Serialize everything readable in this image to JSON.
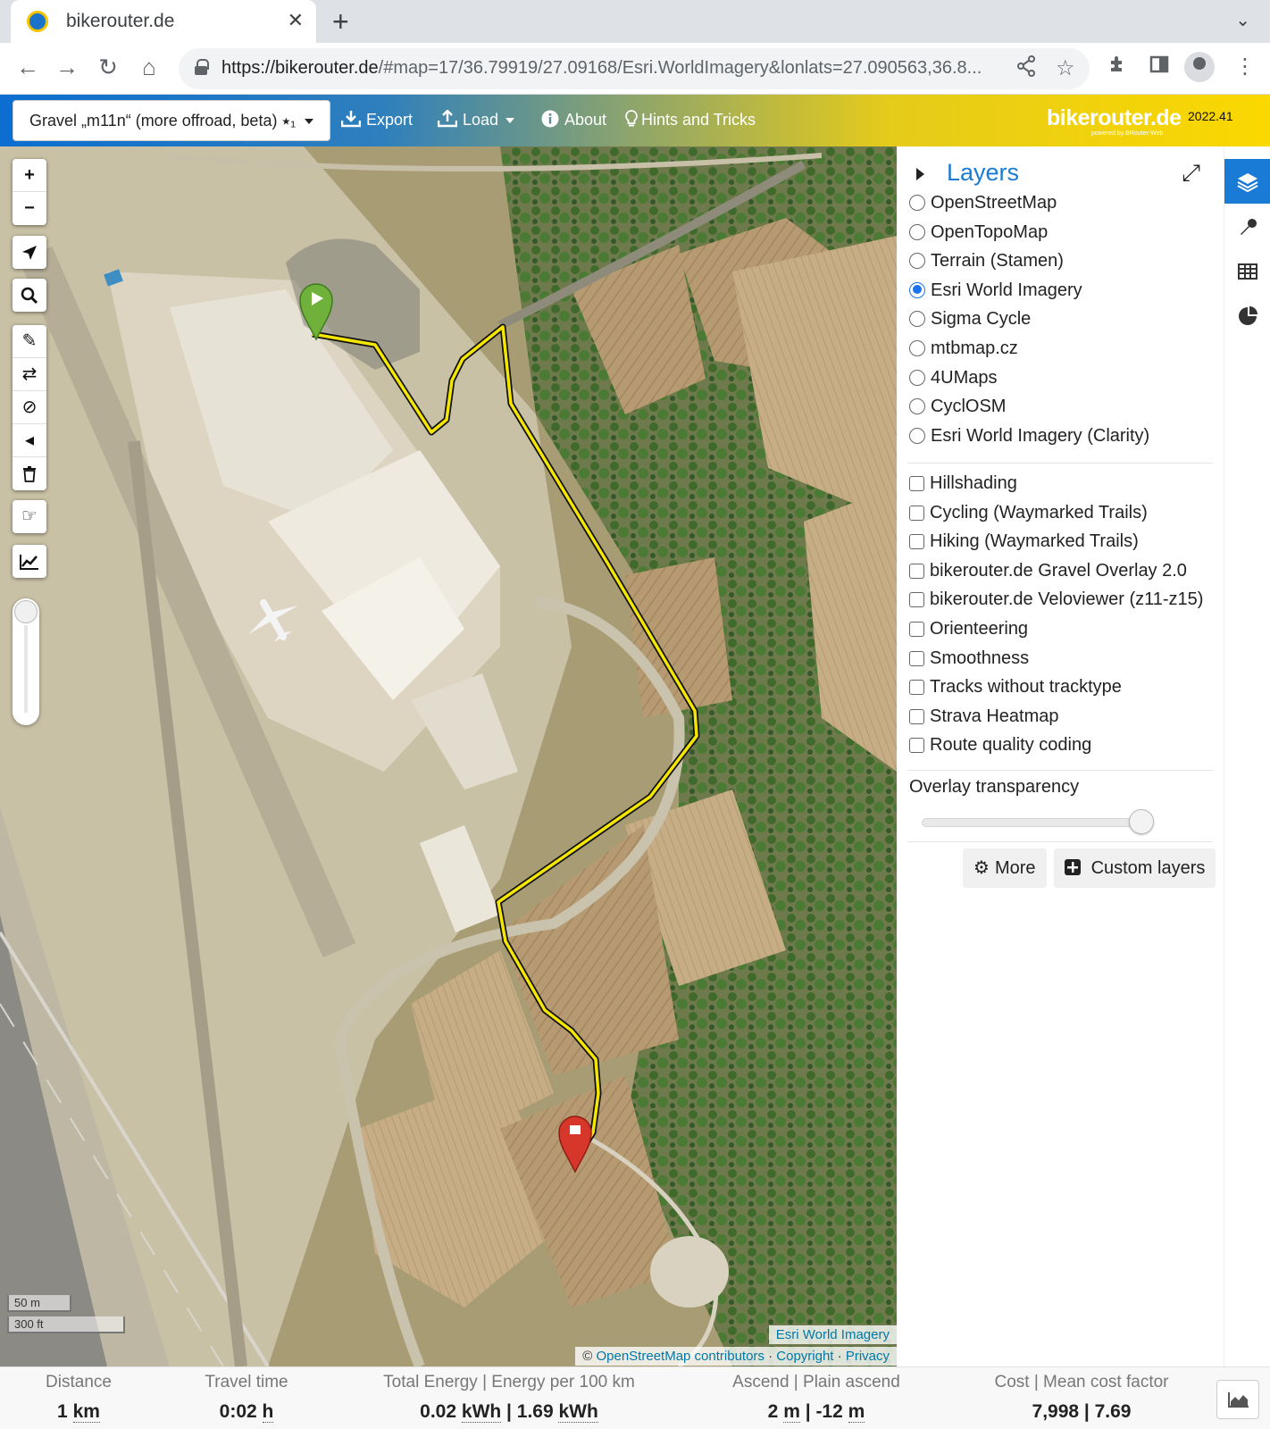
{
  "browser": {
    "tab_title": "bikerouter.de",
    "close_glyph": "✕",
    "newtab_glyph": "+",
    "url_host": "https://bikerouter.de",
    "url_rest": "/#map=17/36.79919/27.09168/Esri.WorldImagery&lonlats=27.090563,36.8..."
  },
  "appbar": {
    "profile": "Gravel „m11n“ (more offroad, beta) ⭑₁",
    "export": "Export",
    "load": "Load",
    "about": "About",
    "hints": "Hints and Tricks",
    "brand": "bikerouter.de",
    "brand_sub": "powered by BRouter-Web",
    "version": "2022.41"
  },
  "map": {
    "scale_metric": "50 m",
    "scale_imperial": "300 ft",
    "imagery_attrib": "Esri World Imagery",
    "attrib_prefix": "© ",
    "attrib_osm": "OpenStreetMap contributors",
    "attrib_sep1": " · ",
    "attrib_copyright": "Copyright",
    "attrib_sep2": " · ",
    "attrib_privacy": "Privacy",
    "route_color": "#f5e600"
  },
  "layers": {
    "title": "Layers",
    "base": [
      {
        "label": "OpenStreetMap",
        "selected": false
      },
      {
        "label": "OpenTopoMap",
        "selected": false
      },
      {
        "label": "Terrain (Stamen)",
        "selected": false
      },
      {
        "label": "Esri World Imagery",
        "selected": true
      },
      {
        "label": "Sigma Cycle",
        "selected": false
      },
      {
        "label": "mtbmap.cz",
        "selected": false
      },
      {
        "label": "4UMaps",
        "selected": false
      },
      {
        "label": "CyclOSM",
        "selected": false
      },
      {
        "label": "Esri World Imagery (Clarity)",
        "selected": false
      }
    ],
    "overlays": [
      {
        "label": "Hillshading"
      },
      {
        "label": "Cycling (Waymarked Trails)"
      },
      {
        "label": "Hiking (Waymarked Trails)"
      },
      {
        "label": "bikerouter.de Gravel Overlay 2.0"
      },
      {
        "label": "bikerouter.de Veloviewer (z11-z15)"
      },
      {
        "label": "Orienteering"
      },
      {
        "label": "Smoothness"
      },
      {
        "label": "Tracks without tracktype"
      },
      {
        "label": "Strava Heatmap"
      },
      {
        "label": "Route quality coding"
      }
    ],
    "transparency_label": "Overlay transparency",
    "transparency_value": 0.97,
    "more": "More",
    "custom": "Custom layers"
  },
  "stats": {
    "distance_label": "Distance",
    "distance_num": "1",
    "distance_unit": "km",
    "time_label": "Travel time",
    "time_num": "0:02",
    "time_unit": "h",
    "energy_label": "Total Energy | Energy per 100 km",
    "energy_total": "0.02",
    "energy_per": "1.69",
    "energy_unit": "kWh",
    "ascend_label": "Ascend | Plain ascend",
    "ascend": "2",
    "plain_ascend": "-12",
    "ascend_unit": "m",
    "cost_label": "Cost | Mean cost factor",
    "cost_value": "7,998 | 7.69",
    "value_sep": " | "
  },
  "icons": {
    "zoom_in": "+",
    "zoom_out": "−",
    "locate": "➤",
    "search": "⌕",
    "draw": "✎",
    "shuffle": "⇄",
    "nogo": "⊘",
    "delete_point": "◂",
    "trash": "🗑",
    "reverse": "☞",
    "elevation": "📈",
    "export": "⭳",
    "load": "⭱",
    "about": "ℹ",
    "hints": "💡",
    "back": "←",
    "forward": "→",
    "reload": "↻",
    "home": "⌂",
    "share": "⟨",
    "star": "☆",
    "extensions": "✱",
    "sidepanel": "▯",
    "menu": "⋮",
    "expand": "⤢",
    "more": "⚙",
    "custom": "⊞",
    "layers_tab": "◈",
    "tools_tab": "🔧",
    "table_tab": "▦",
    "stats_tab": "◔"
  }
}
